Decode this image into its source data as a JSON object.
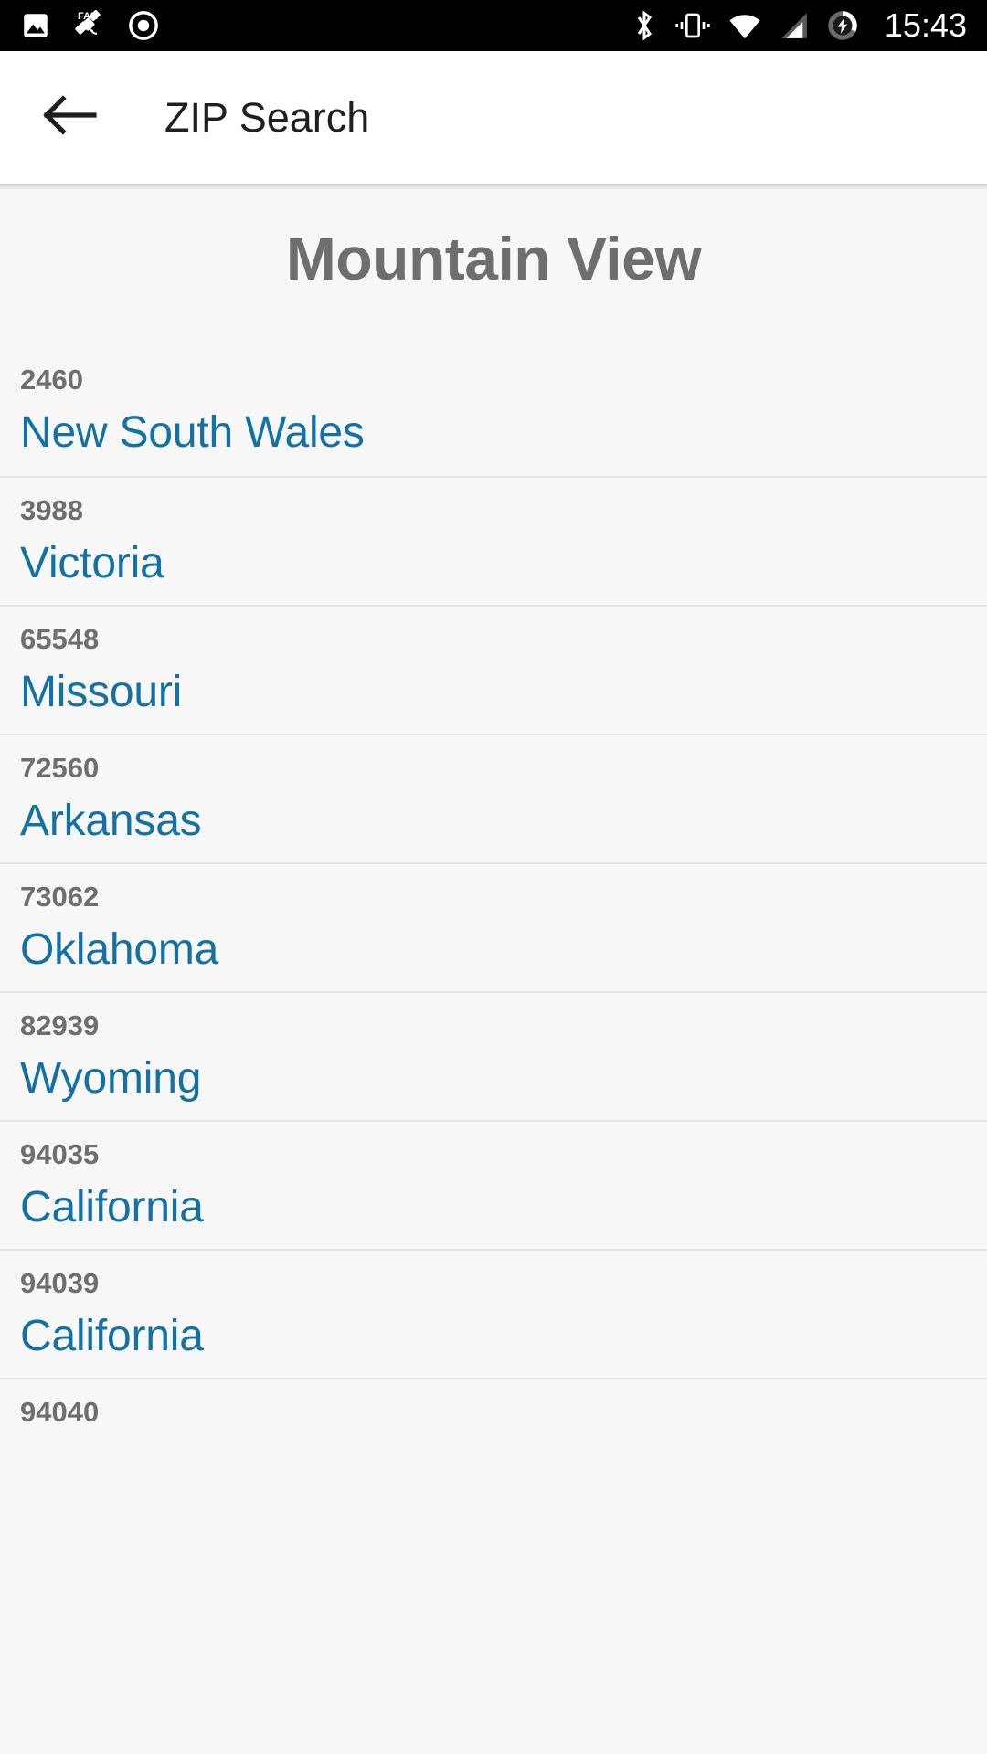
{
  "statusbar": {
    "time": "15:43",
    "left_icons": [
      {
        "name": "image-icon",
        "label": "image"
      },
      {
        "name": "fake-gps-satellite-icon",
        "label": "FAKE"
      },
      {
        "name": "record-dot-icon",
        "label": "recording"
      }
    ],
    "right_icons": [
      {
        "name": "bluetooth-icon",
        "label": "bluetooth"
      },
      {
        "name": "vibrate-icon",
        "label": "vibrate"
      },
      {
        "name": "wifi-icon",
        "label": "wifi"
      },
      {
        "name": "cell-signal-icon",
        "label": "cellular"
      },
      {
        "name": "battery-charging-icon",
        "label": "battery charging"
      }
    ]
  },
  "appbar": {
    "back_label": "back",
    "title": "ZIP Search"
  },
  "content": {
    "city": "Mountain View",
    "rows": [
      {
        "zip": "2460",
        "state": "New South Wales"
      },
      {
        "zip": "3988",
        "state": "Victoria"
      },
      {
        "zip": "65548",
        "state": "Missouri"
      },
      {
        "zip": "72560",
        "state": "Arkansas"
      },
      {
        "zip": "73062",
        "state": "Oklahoma"
      },
      {
        "zip": "82939",
        "state": "Wyoming"
      },
      {
        "zip": "94035",
        "state": "California"
      },
      {
        "zip": "94039",
        "state": "California"
      },
      {
        "zip": "94040",
        "state": ""
      }
    ]
  },
  "colors": {
    "statusbar_bg": "#000000",
    "appbar_bg": "#ffffff",
    "content_bg": "#f7f7f7",
    "zip_text": "#6e6e6e",
    "state_link": "#1471a3",
    "divider": "#e2e2e2",
    "heading": "#6e6e6e"
  }
}
